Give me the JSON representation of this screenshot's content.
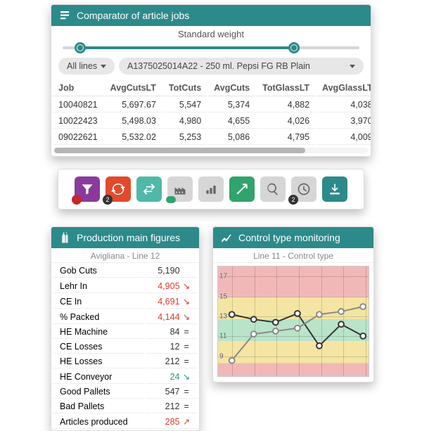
{
  "comparator": {
    "title": "Comparator of article jobs",
    "slider_label": "Standard weight",
    "slider": {
      "min": 0,
      "max": 100,
      "a": 6,
      "b": 78
    },
    "lines_dd": "All lines",
    "article_dd": "A1375025014A22 - 250 ml. Pepsi FG RB Plain",
    "columns": [
      "Job",
      "AvgCutsLT",
      "TotCuts",
      "AvgCuts",
      "TotGlassLT",
      "AvgGlassLT"
    ],
    "rows": [
      [
        "10040821",
        "5,697.67",
        "5,547",
        "5,374",
        "4,882",
        "4,038"
      ],
      [
        "10022423",
        "5,498.03",
        "4,980",
        "4,655",
        "4,026",
        "3,970"
      ],
      [
        "09022621",
        "5,532.02",
        "5,253",
        "5,086",
        "4,795",
        "4,009"
      ]
    ]
  },
  "toolbar": {
    "buttons": [
      {
        "name": "filter-icon",
        "color": "purple",
        "badge": {
          "style": "red",
          "text": ""
        }
      },
      {
        "name": "sync-icon",
        "color": "orange",
        "badge": {
          "style": "dark",
          "text": "2"
        }
      },
      {
        "name": "swap-icon",
        "color": "teal2",
        "badge": null
      },
      {
        "name": "factory-icon",
        "color": "gray",
        "badge": {
          "style": "greenb",
          "text": ""
        }
      },
      {
        "name": "pallets-icon",
        "color": "gray",
        "badge": null
      },
      {
        "name": "trend-up-icon",
        "color": "green",
        "badge": null
      },
      {
        "name": "search-icon",
        "color": "gray",
        "badge": null
      },
      {
        "name": "timer-icon",
        "color": "gray",
        "badge": {
          "style": "dark",
          "text": "2"
        }
      },
      {
        "name": "download-icon",
        "color": "teal",
        "badge": null
      }
    ]
  },
  "production": {
    "title": "Production main figures",
    "subtitle": "Avigliana - Line 12",
    "rows": [
      {
        "label": "Gob Cuts",
        "value": "5,190",
        "color": "dark",
        "trend": ""
      },
      {
        "label": "Lehr In",
        "value": "4,905",
        "color": "red",
        "trend": "↘"
      },
      {
        "label": "CE In",
        "value": "4,691",
        "color": "red",
        "trend": "↘"
      },
      {
        "label": "% Packed",
        "value": "4,144",
        "color": "red",
        "trend": "↘"
      },
      {
        "label": "HE Machine",
        "value": "84",
        "color": "dark",
        "trend": "="
      },
      {
        "label": "CE Losses",
        "value": "12",
        "color": "dark",
        "trend": "="
      },
      {
        "label": "HE Losses",
        "value": "212",
        "color": "dark",
        "trend": "="
      },
      {
        "label": "HE Conveyor",
        "value": "24",
        "color": "green",
        "trend": "↘"
      },
      {
        "label": "Good Pallets",
        "value": "547",
        "color": "dark",
        "trend": "="
      },
      {
        "label": "Bad Pallets",
        "value": "212",
        "color": "dark",
        "trend": "="
      },
      {
        "label": "Articles produced",
        "value": "285",
        "color": "red",
        "trend": "↗"
      }
    ]
  },
  "control": {
    "title": "Control type monitoring",
    "subtitle": "Line 11 - Control type"
  },
  "chart_data": {
    "type": "line",
    "x": [
      1,
      2,
      3,
      4,
      5,
      6,
      7
    ],
    "ylim": [
      7,
      18
    ],
    "yticks": [
      9,
      11,
      13,
      15,
      17
    ],
    "series": [
      {
        "name": "series-a",
        "values": [
          13.2,
          12.7,
          12.4,
          13.3,
          10.0,
          12.2,
          11.0
        ],
        "color": "#333333"
      },
      {
        "name": "series-b",
        "values": [
          8.5,
          11.2,
          11.5,
          11.8,
          13.2,
          13.5,
          14.0
        ],
        "color": "#888888"
      }
    ],
    "bands": [
      {
        "from": 15.0,
        "to": 18.0,
        "color": "#f2b8b8"
      },
      {
        "from": 13.0,
        "to": 15.0,
        "color": "#f4e5a3"
      },
      {
        "from": 11.0,
        "to": 13.0,
        "color": "#b9e4c9"
      },
      {
        "from": 9.0,
        "to": 11.0,
        "color": "#f4e5a3"
      },
      {
        "from": 7.0,
        "to": 9.0,
        "color": "#f2b8b8"
      }
    ]
  }
}
